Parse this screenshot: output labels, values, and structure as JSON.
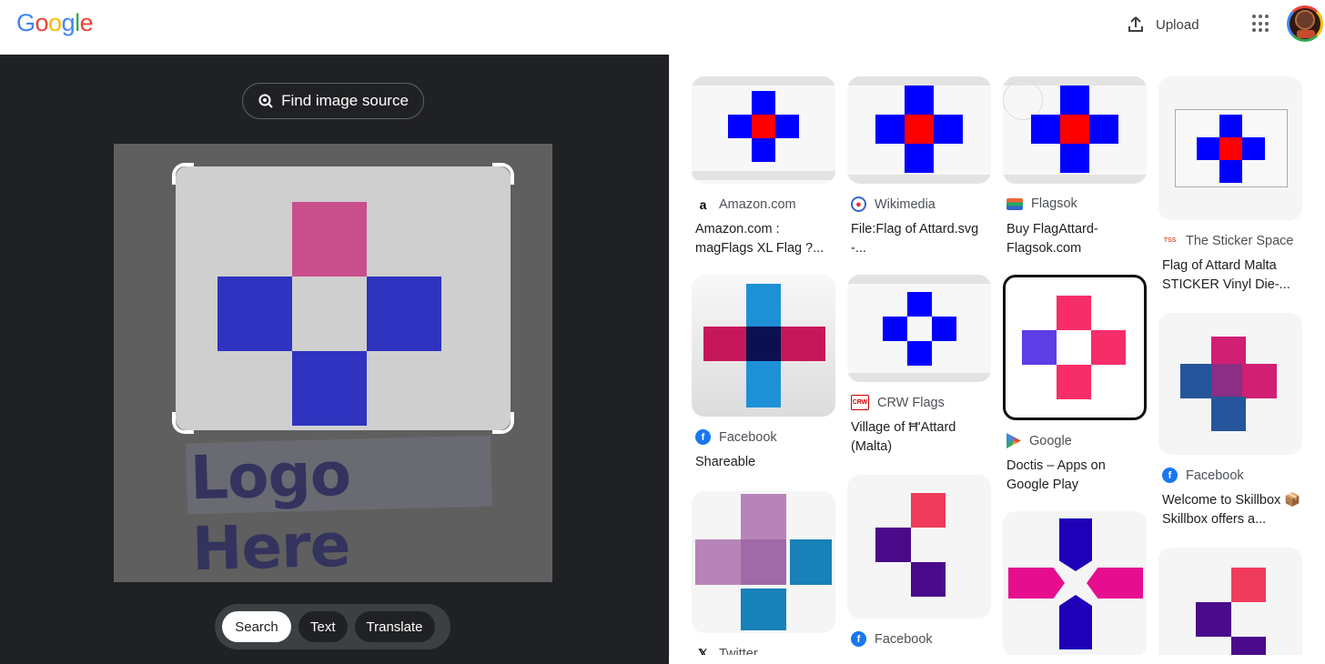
{
  "header": {
    "logo": [
      "G",
      "o",
      "o",
      "g",
      "l",
      "e"
    ],
    "logo_colors": [
      "#4285f4",
      "#ea4335",
      "#fbbc05",
      "#4285f4",
      "#34a853",
      "#ea4335"
    ],
    "upload_label": "Upload",
    "upload_icon": "upload-icon",
    "apps_icon": "apps-grid-icon"
  },
  "lens": {
    "find_source_label": "Find image source",
    "overlay_text": "Logo Here",
    "modes": [
      "Search",
      "Text",
      "Translate"
    ],
    "active_mode": "Search",
    "colors": {
      "pink": "#c94f8c",
      "blue": "#2f33c0"
    }
  },
  "results": [
    {
      "source": "Amazon.com",
      "title": "Amazon.com : magFlags XL Flag ?...",
      "favicon": "amazon-icon"
    },
    {
      "source": "Wikimedia",
      "title": "File:Flag of Attard.svg -...",
      "favicon": "wikimedia-icon"
    },
    {
      "source": "Flagsok",
      "title": "Buy FlagAttard-Flagsok.com",
      "favicon": "flagsok-icon"
    },
    {
      "source": "The Sticker Space",
      "title": "Flag of Attard Malta STICKER Vinyl Die-...",
      "favicon": "sticker-space-icon"
    },
    {
      "source": "Facebook",
      "title": "Shareable",
      "favicon": "facebook-icon"
    },
    {
      "source": "CRW Flags",
      "title": "Village of Ħ'Attard (Malta)",
      "favicon": "crw-flags-icon"
    },
    {
      "source": "Google",
      "title": "Doctis – Apps on Google Play",
      "favicon": "google-play-icon"
    },
    {
      "source": "Facebook",
      "title": "Welcome to Skillbox 📦 Skillbox offers a...",
      "favicon": "facebook-icon"
    },
    {
      "source": "Twitter",
      "title": "",
      "favicon": "x-twitter-icon"
    },
    {
      "source": "Facebook",
      "title": "",
      "favicon": "facebook-icon"
    }
  ]
}
